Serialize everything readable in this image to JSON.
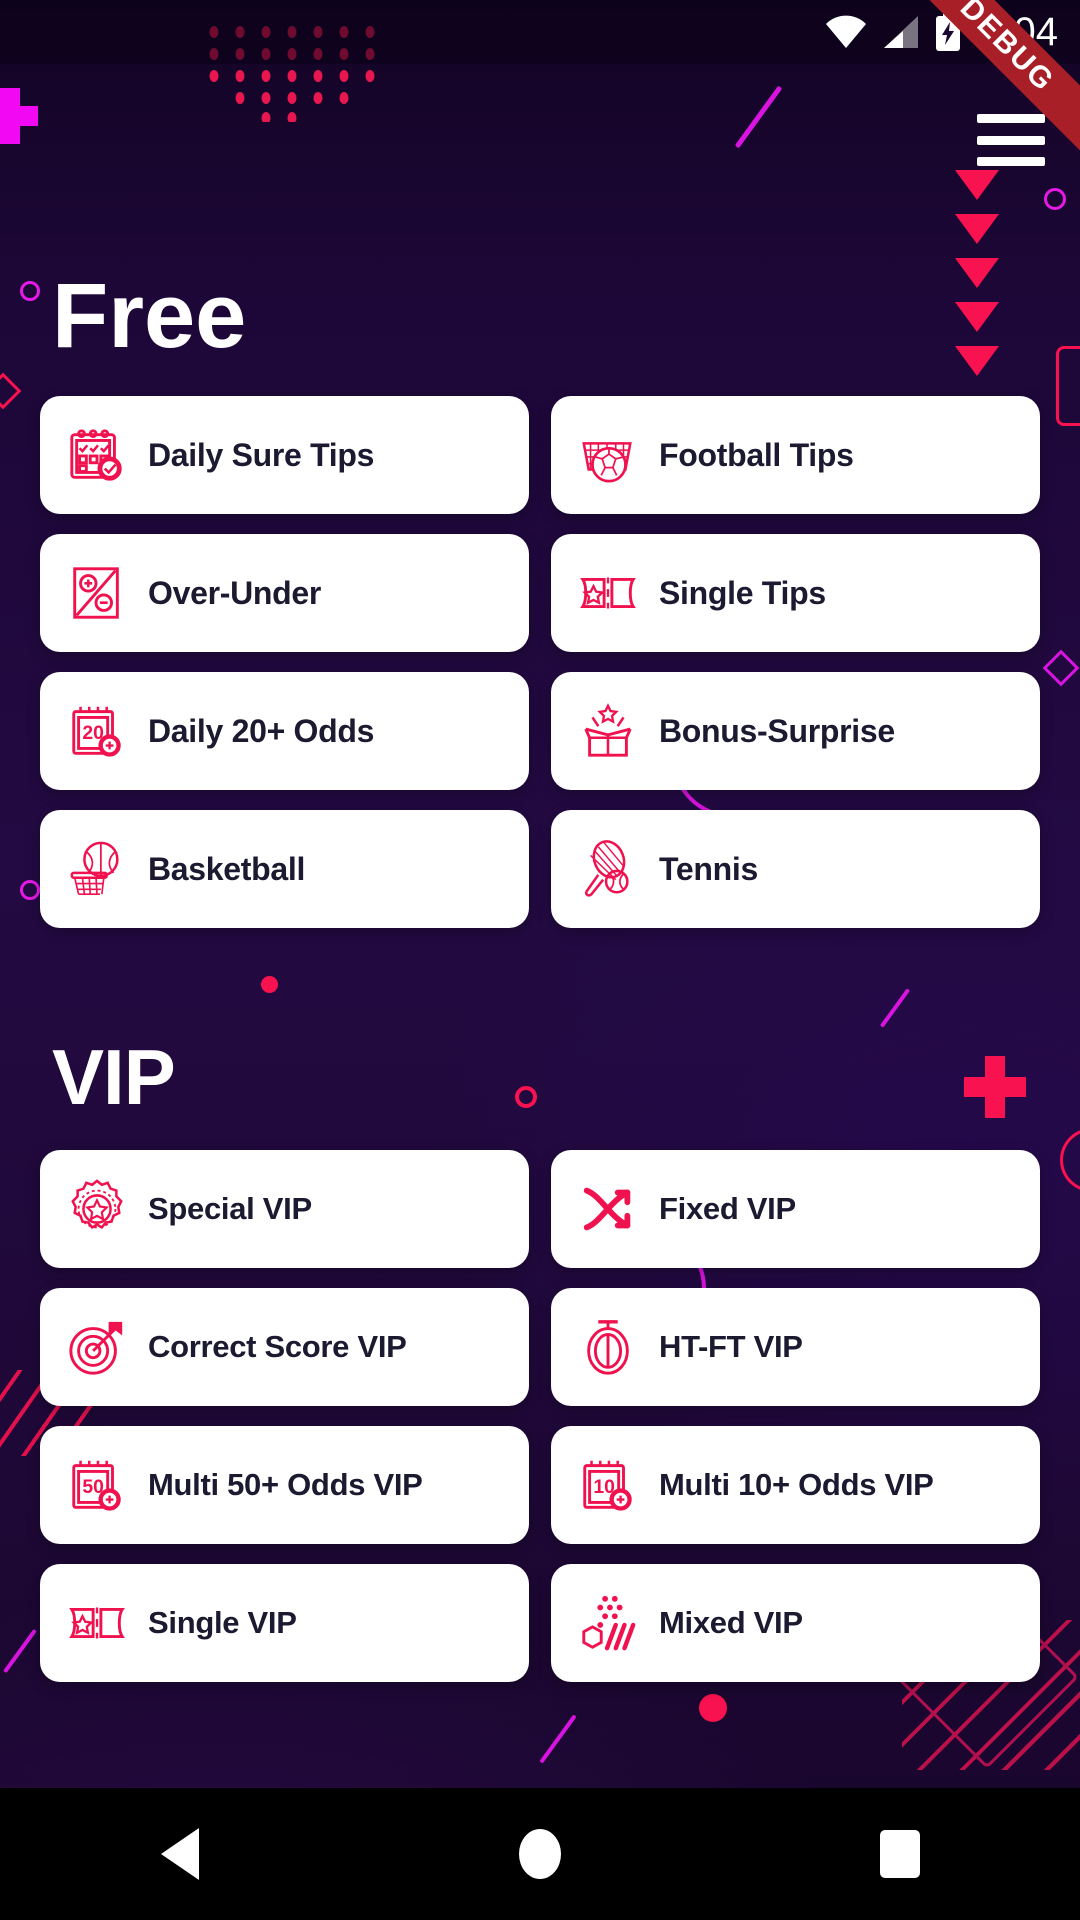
{
  "statusbar": {
    "time": "9:04",
    "wifi_icon": "wifi-icon",
    "signal_icon": "cellular-signal-icon",
    "battery_icon": "battery-charging-icon",
    "debug_label": "DEBUG"
  },
  "header": {
    "menu_icon": "hamburger-menu-icon"
  },
  "sections": [
    {
      "id": "free",
      "title": "Free",
      "items": [
        {
          "label": "Daily Sure Tips",
          "icon": "calendar-check-icon"
        },
        {
          "label": "Football Tips",
          "icon": "football-goal-icon"
        },
        {
          "label": "Over-Under",
          "icon": "percent-plus-minus-icon"
        },
        {
          "label": "Single Tips",
          "icon": "ticket-star-icon"
        },
        {
          "label": "Daily 20+ Odds",
          "icon": "calendar-20-plus-icon"
        },
        {
          "label": "Bonus-Surprise",
          "icon": "gift-box-icon"
        },
        {
          "label": "Basketball",
          "icon": "basketball-hoop-icon"
        },
        {
          "label": "Tennis",
          "icon": "tennis-racket-icon"
        }
      ]
    },
    {
      "id": "vip",
      "title": "VIP",
      "items": [
        {
          "label": "Special VIP",
          "icon": "badge-star-icon"
        },
        {
          "label": "Fixed VIP",
          "icon": "shuffle-arrows-icon"
        },
        {
          "label": "Correct Score VIP",
          "icon": "target-dart-icon"
        },
        {
          "label": "HT-FT VIP",
          "icon": "stopwatch-icon"
        },
        {
          "label": "Multi 50+ Odds VIP",
          "icon": "calendar-50-plus-icon"
        },
        {
          "label": "Multi 10+ Odds VIP",
          "icon": "calendar-10-plus-icon"
        },
        {
          "label": "Single VIP",
          "icon": "ticket-star-icon"
        },
        {
          "label": "Mixed VIP",
          "icon": "mixed-dots-icon"
        }
      ]
    }
  ],
  "navbar": {
    "back_icon": "back-triangle-icon",
    "home_icon": "home-circle-icon",
    "recents_icon": "recents-square-icon"
  },
  "colors": {
    "accent_pink": "#f8124f",
    "accent_magenta": "#e619e6",
    "background": "#230a42",
    "card": "#ffffff",
    "card_text": "#1b1a30",
    "debug_ribbon": "#a81f28"
  },
  "icon_badges": {
    "daily_20": "20",
    "multi_50": "50",
    "multi_10": "10"
  }
}
